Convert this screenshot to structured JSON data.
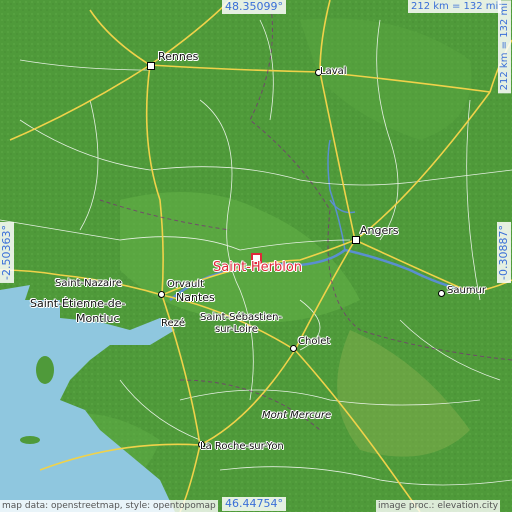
{
  "map": {
    "coords": {
      "top": "48.35099°",
      "bottom": "46.44754°",
      "left": "-2.50363°",
      "right": "-0.30887°"
    },
    "scale": {
      "top": "212 km = 132 mi",
      "right": "212 km = 132 mi"
    },
    "credits": {
      "left": "map data: openstreetmap, style: opentopomap",
      "right": "image proc.: elevation.city"
    },
    "highlight": "Saint-Herblon",
    "places": {
      "rennes": "Rennes",
      "laval": "Laval",
      "angers": "Angers",
      "saint_nazaire": "Saint-Nazaire",
      "orvault": "Orvault",
      "nantes": "Nantes",
      "saint_etienne": "Saint-Étienne-de-",
      "montluc": "Montluc",
      "reze": "Rezé",
      "saint_sebastien": "Saint-Sébastien-",
      "sur_loire": "sur-Loire",
      "cholet": "Cholet",
      "saumur": "Saumur",
      "mont_mercure": "Mont Mercure",
      "la_roche": "La Roche-sur-Yon"
    },
    "colors": {
      "land": "#4f9a3a",
      "lowland": "#6fb84b",
      "sea": "#8fc7df",
      "river": "#5a8fd0",
      "highway": "#f0d24a",
      "road": "#ffffff",
      "highlight": "#e0283a",
      "coord_text": "#3a6fd8"
    }
  }
}
